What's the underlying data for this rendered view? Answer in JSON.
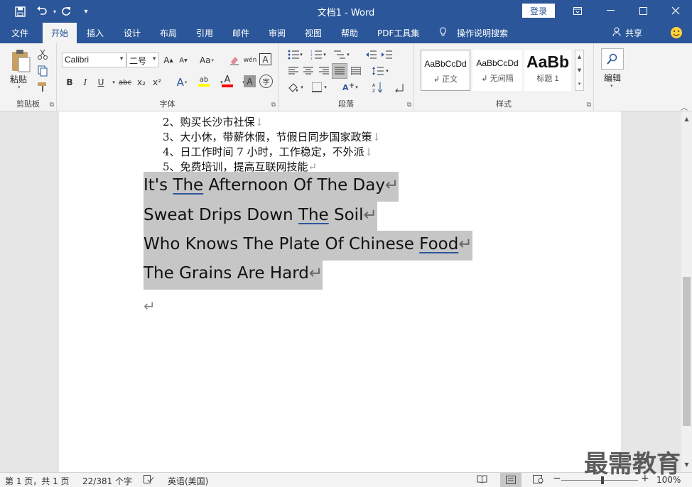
{
  "window": {
    "title": "文档1  -  Word",
    "login_label": "登录"
  },
  "quick_access": {
    "save_icon": "save-icon",
    "undo_icon": "undo-icon",
    "redo_icon": "redo-icon",
    "customize_icon": "customize-icon"
  },
  "window_controls": {
    "ribbon_options_icon": "ribbon-display-options-icon",
    "minimize_icon": "minimize-icon",
    "maximize_icon": "maximize-icon",
    "close_icon": "close-icon"
  },
  "tabs": [
    {
      "label": "文件"
    },
    {
      "label": "开始"
    },
    {
      "label": "插入"
    },
    {
      "label": "设计"
    },
    {
      "label": "布局"
    },
    {
      "label": "引用"
    },
    {
      "label": "邮件"
    },
    {
      "label": "审阅"
    },
    {
      "label": "视图"
    },
    {
      "label": "帮助"
    },
    {
      "label": "PDF工具集"
    }
  ],
  "active_tab": "开始",
  "tell_me": {
    "label": "操作说明搜索"
  },
  "share": {
    "label": "共享"
  },
  "ribbon": {
    "clipboard": {
      "label": "剪贴板",
      "paste_label": "粘贴"
    },
    "font": {
      "label": "字体",
      "font_name": "Calibri",
      "font_size": "二号",
      "bold": "B",
      "italic": "I",
      "underline": "U",
      "strike": "abc",
      "subscript": "x₂",
      "superscript": "x²",
      "grow": "A",
      "shrink": "A",
      "change_case": "Aa",
      "phonetic": "wén",
      "border_char": "A",
      "text_effects": "A",
      "highlight": "ab",
      "font_color": "A",
      "shading": "A",
      "enclose": "字",
      "highlight_color": "#ffff00",
      "font_color_value": "#ff0000"
    },
    "paragraph": {
      "label": "段落"
    },
    "styles": {
      "label": "样式",
      "items": [
        {
          "preview": "AaBbCcDd",
          "name": "正文"
        },
        {
          "preview": "AaBbCcDd",
          "name": "无间隔"
        },
        {
          "preview": "AaBb",
          "name": "标题 1"
        }
      ]
    },
    "editing": {
      "label": "编辑"
    }
  },
  "document": {
    "list_items": [
      "2、购买长沙市社保",
      "3、大小休，带薪休假，节假日同步国家政策",
      "4、日工作时间 7 小时，工作稳定，不外派",
      "5、免费培训，提高互联网技能"
    ],
    "line_break_mark": "↓",
    "para_mark": "↵",
    "selected_lines": [
      {
        "before": "It's ",
        "underlined": "The",
        "after": " Afternoon Of The Day"
      },
      {
        "before": "Sweat Drips Down ",
        "underlined": "The",
        "after": " Soil"
      },
      {
        "before": "Who Knows The Plate Of Chinese ",
        "underlined": "Food",
        "after": ""
      },
      {
        "before": "The Grains Are Hard",
        "underlined": "",
        "after": ""
      }
    ],
    "selection_color": "#c6c6c6"
  },
  "status": {
    "page": "第 1 页，共 1 页",
    "words": "22/381 个字",
    "language": "英语(美国)",
    "zoom": "100%",
    "zoom_minus": "−",
    "zoom_plus": "+"
  },
  "watermark": "最需教育"
}
